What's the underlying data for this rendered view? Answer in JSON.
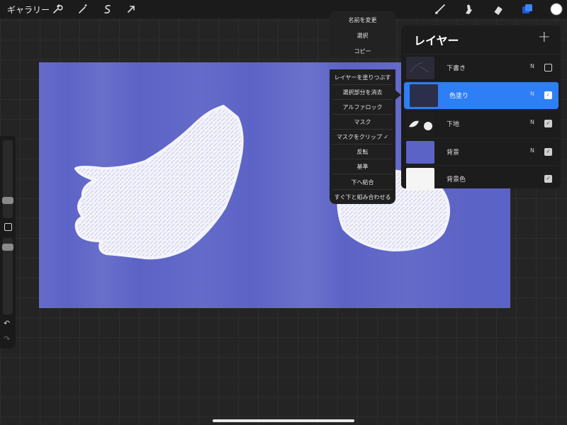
{
  "toolbar": {
    "gallery_label": "ギャラリー",
    "left_tools": [
      "wrench-icon",
      "magic-wand-icon",
      "selection-icon",
      "transform-arrow-icon"
    ],
    "right_tools": [
      "brush-icon",
      "smudge-icon",
      "eraser-icon",
      "layers-icon",
      "color-icon"
    ],
    "accent": "#2e7ff5"
  },
  "layer_menu": {
    "header_items": [
      "名前を変更",
      "選択",
      "コピー"
    ],
    "items": [
      "レイヤーを塗りつぶす",
      "選択部分を消去",
      "アルファロック",
      "マスク",
      "マスクをクリップ ✓",
      "反転",
      "基準",
      "下へ結合",
      "すぐ下と組み合わせる"
    ]
  },
  "layers_panel": {
    "title": "レイヤー",
    "add_symbol": "+",
    "layers": [
      {
        "name": "下書き",
        "mode": "N",
        "visible": false,
        "active": false
      },
      {
        "name": "色塗り",
        "mode": "N",
        "visible": true,
        "active": true
      },
      {
        "name": "下地",
        "mode": "N",
        "visible": true,
        "active": false
      },
      {
        "name": "背景",
        "mode": "N",
        "visible": true,
        "active": false
      },
      {
        "name": "背景色",
        "mode": "",
        "visible": true,
        "active": false
      }
    ]
  },
  "sidebar": {
    "undo_icon": "↶",
    "redo_icon": "↷"
  },
  "colors": {
    "canvas_blue": "#5c63c6",
    "fruit_white": "#f2f2f8",
    "current_color": "#ffffff"
  }
}
